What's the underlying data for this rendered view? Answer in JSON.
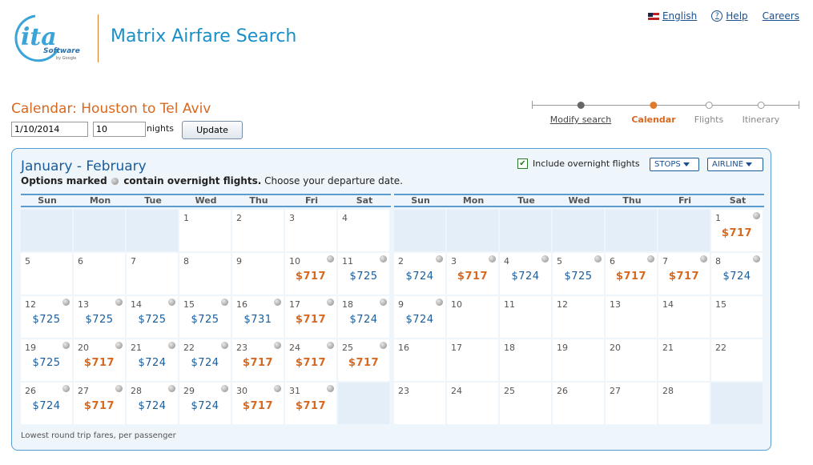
{
  "app": {
    "title": "Matrix Airfare Search",
    "logo_text": "ita",
    "logo_sub": "Software",
    "logo_by": "by Google"
  },
  "toplinks": {
    "language": "English",
    "help": "Help",
    "careers": "Careers"
  },
  "search": {
    "heading": "Calendar: Houston to Tel Aviv",
    "date": "1/10/2014",
    "nights": "10",
    "nights_label": "nights",
    "update_label": "Update"
  },
  "steps": [
    {
      "label": "Modify search",
      "state": "done"
    },
    {
      "label": "Calendar",
      "state": "current"
    },
    {
      "label": "Flights",
      "state": "future"
    },
    {
      "label": "Itinerary",
      "state": "future"
    }
  ],
  "panel": {
    "title": "January - February",
    "subtitle_bold_1": "Options marked",
    "subtitle_bold_2": "contain overnight flights.",
    "subtitle_rest": "Choose your departure date.",
    "overnight_label": "Include overnight flights",
    "overnight_checked": true,
    "stops_label": "STOPS",
    "airline_label": "AIRLINE",
    "footnote": "Lowest round trip fares, per passenger"
  },
  "weekdays": [
    "Sun",
    "Mon",
    "Tue",
    "Wed",
    "Thu",
    "Fri",
    "Sat"
  ],
  "colors": {
    "accent": "#d9681f",
    "link": "#1a5c9a",
    "panel_bg": "#eef5fb"
  },
  "months": [
    {
      "name": "January",
      "cells": [
        null,
        null,
        null,
        {
          "d": "1"
        },
        {
          "d": "2"
        },
        {
          "d": "3"
        },
        {
          "d": "4"
        },
        {
          "d": "5"
        },
        {
          "d": "6"
        },
        {
          "d": "7"
        },
        {
          "d": "8"
        },
        {
          "d": "9"
        },
        {
          "d": "10",
          "p": "$717",
          "low": true,
          "o": true
        },
        {
          "d": "11",
          "p": "$725",
          "o": true
        },
        {
          "d": "12",
          "p": "$725",
          "o": true
        },
        {
          "d": "13",
          "p": "$725",
          "o": true
        },
        {
          "d": "14",
          "p": "$725",
          "o": true
        },
        {
          "d": "15",
          "p": "$725",
          "o": true
        },
        {
          "d": "16",
          "p": "$731",
          "o": true
        },
        {
          "d": "17",
          "p": "$717",
          "low": true,
          "o": true
        },
        {
          "d": "18",
          "p": "$724",
          "o": true
        },
        {
          "d": "19",
          "p": "$725",
          "o": true
        },
        {
          "d": "20",
          "p": "$717",
          "low": true,
          "o": true
        },
        {
          "d": "21",
          "p": "$724",
          "o": true
        },
        {
          "d": "22",
          "p": "$724",
          "o": true
        },
        {
          "d": "23",
          "p": "$717",
          "low": true,
          "o": true
        },
        {
          "d": "24",
          "p": "$717",
          "low": true,
          "o": true
        },
        {
          "d": "25",
          "p": "$717",
          "low": true,
          "o": true
        },
        {
          "d": "26",
          "p": "$724",
          "o": true
        },
        {
          "d": "27",
          "p": "$717",
          "low": true,
          "o": true
        },
        {
          "d": "28",
          "p": "$724",
          "o": true
        },
        {
          "d": "29",
          "p": "$724",
          "o": true
        },
        {
          "d": "30",
          "p": "$717",
          "low": true,
          "o": true
        },
        {
          "d": "31",
          "p": "$717",
          "low": true,
          "o": true
        },
        null
      ]
    },
    {
      "name": "February",
      "cells": [
        null,
        null,
        null,
        null,
        null,
        null,
        {
          "d": "1",
          "p": "$717",
          "low": true,
          "o": true
        },
        {
          "d": "2",
          "p": "$724",
          "o": true
        },
        {
          "d": "3",
          "p": "$717",
          "low": true,
          "o": true
        },
        {
          "d": "4",
          "p": "$724",
          "o": true
        },
        {
          "d": "5",
          "p": "$725",
          "o": true
        },
        {
          "d": "6",
          "p": "$717",
          "low": true,
          "o": true
        },
        {
          "d": "7",
          "p": "$717",
          "low": true,
          "o": true
        },
        {
          "d": "8",
          "p": "$724",
          "o": true
        },
        {
          "d": "9",
          "p": "$724",
          "o": true
        },
        {
          "d": "10"
        },
        {
          "d": "11"
        },
        {
          "d": "12"
        },
        {
          "d": "13"
        },
        {
          "d": "14"
        },
        {
          "d": "15"
        },
        {
          "d": "16"
        },
        {
          "d": "17"
        },
        {
          "d": "18"
        },
        {
          "d": "19"
        },
        {
          "d": "20"
        },
        {
          "d": "21"
        },
        {
          "d": "22"
        },
        {
          "d": "23"
        },
        {
          "d": "24"
        },
        {
          "d": "25"
        },
        {
          "d": "26"
        },
        {
          "d": "27"
        },
        {
          "d": "28"
        },
        null
      ]
    }
  ]
}
